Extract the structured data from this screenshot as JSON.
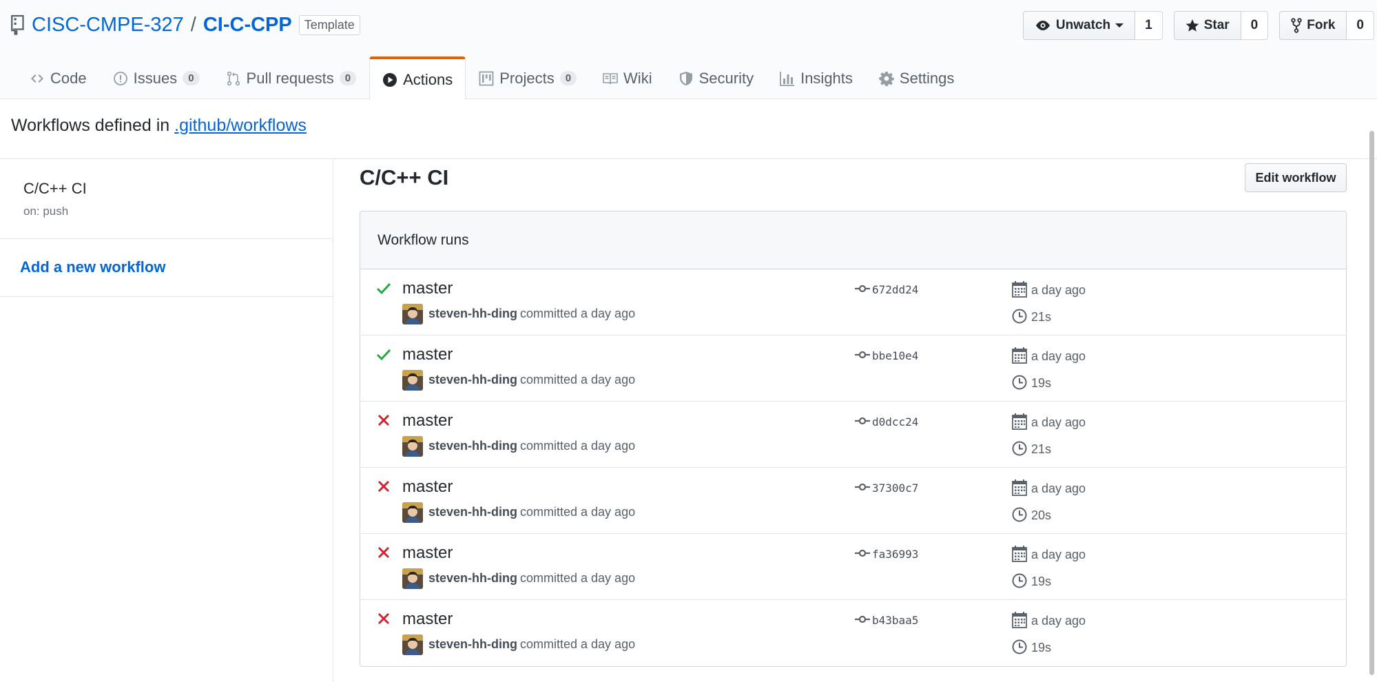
{
  "repo": {
    "owner": "CISC-CMPE-327",
    "separator": "/",
    "name": "CI-C-CPP",
    "badge": "Template"
  },
  "actions": {
    "watch": {
      "label": "Unwatch",
      "count": "1"
    },
    "star": {
      "label": "Star",
      "count": "0"
    },
    "fork": {
      "label": "Fork",
      "count": "0"
    }
  },
  "nav": {
    "code": "Code",
    "issues": "Issues",
    "issues_count": "0",
    "pulls": "Pull requests",
    "pulls_count": "0",
    "actions": "Actions",
    "projects": "Projects",
    "projects_count": "0",
    "wiki": "Wiki",
    "security": "Security",
    "insights": "Insights",
    "settings": "Settings"
  },
  "defined": {
    "prefix": "Workflows defined in",
    "path": ".github/workflows"
  },
  "sidebar": {
    "workflow_name": "C/C++ CI",
    "workflow_trigger": "on: push",
    "add_workflow": "Add a new workflow"
  },
  "main": {
    "title": "C/C++ CI",
    "edit_button": "Edit workflow",
    "runs_header": "Workflow runs"
  },
  "runs": [
    {
      "status": "success",
      "branch": "master",
      "author": "steven-hh-ding",
      "committed": "committed a day ago",
      "sha": "672dd24",
      "when": "a day ago",
      "duration": "21s"
    },
    {
      "status": "success",
      "branch": "master",
      "author": "steven-hh-ding",
      "committed": "committed a day ago",
      "sha": "bbe10e4",
      "when": "a day ago",
      "duration": "19s"
    },
    {
      "status": "failure",
      "branch": "master",
      "author": "steven-hh-ding",
      "committed": "committed a day ago",
      "sha": "d0dcc24",
      "when": "a day ago",
      "duration": "21s"
    },
    {
      "status": "failure",
      "branch": "master",
      "author": "steven-hh-ding",
      "committed": "committed a day ago",
      "sha": "37300c7",
      "when": "a day ago",
      "duration": "20s"
    },
    {
      "status": "failure",
      "branch": "master",
      "author": "steven-hh-ding",
      "committed": "committed a day ago",
      "sha": "fa36993",
      "when": "a day ago",
      "duration": "19s"
    },
    {
      "status": "failure",
      "branch": "master",
      "author": "steven-hh-ding",
      "committed": "committed a day ago",
      "sha": "b43baa5",
      "when": "a day ago",
      "duration": "19s"
    }
  ],
  "colors": {
    "link": "#0366d6",
    "success": "#28a745",
    "failure": "#cb2431",
    "selected_tab": "#e36209"
  }
}
